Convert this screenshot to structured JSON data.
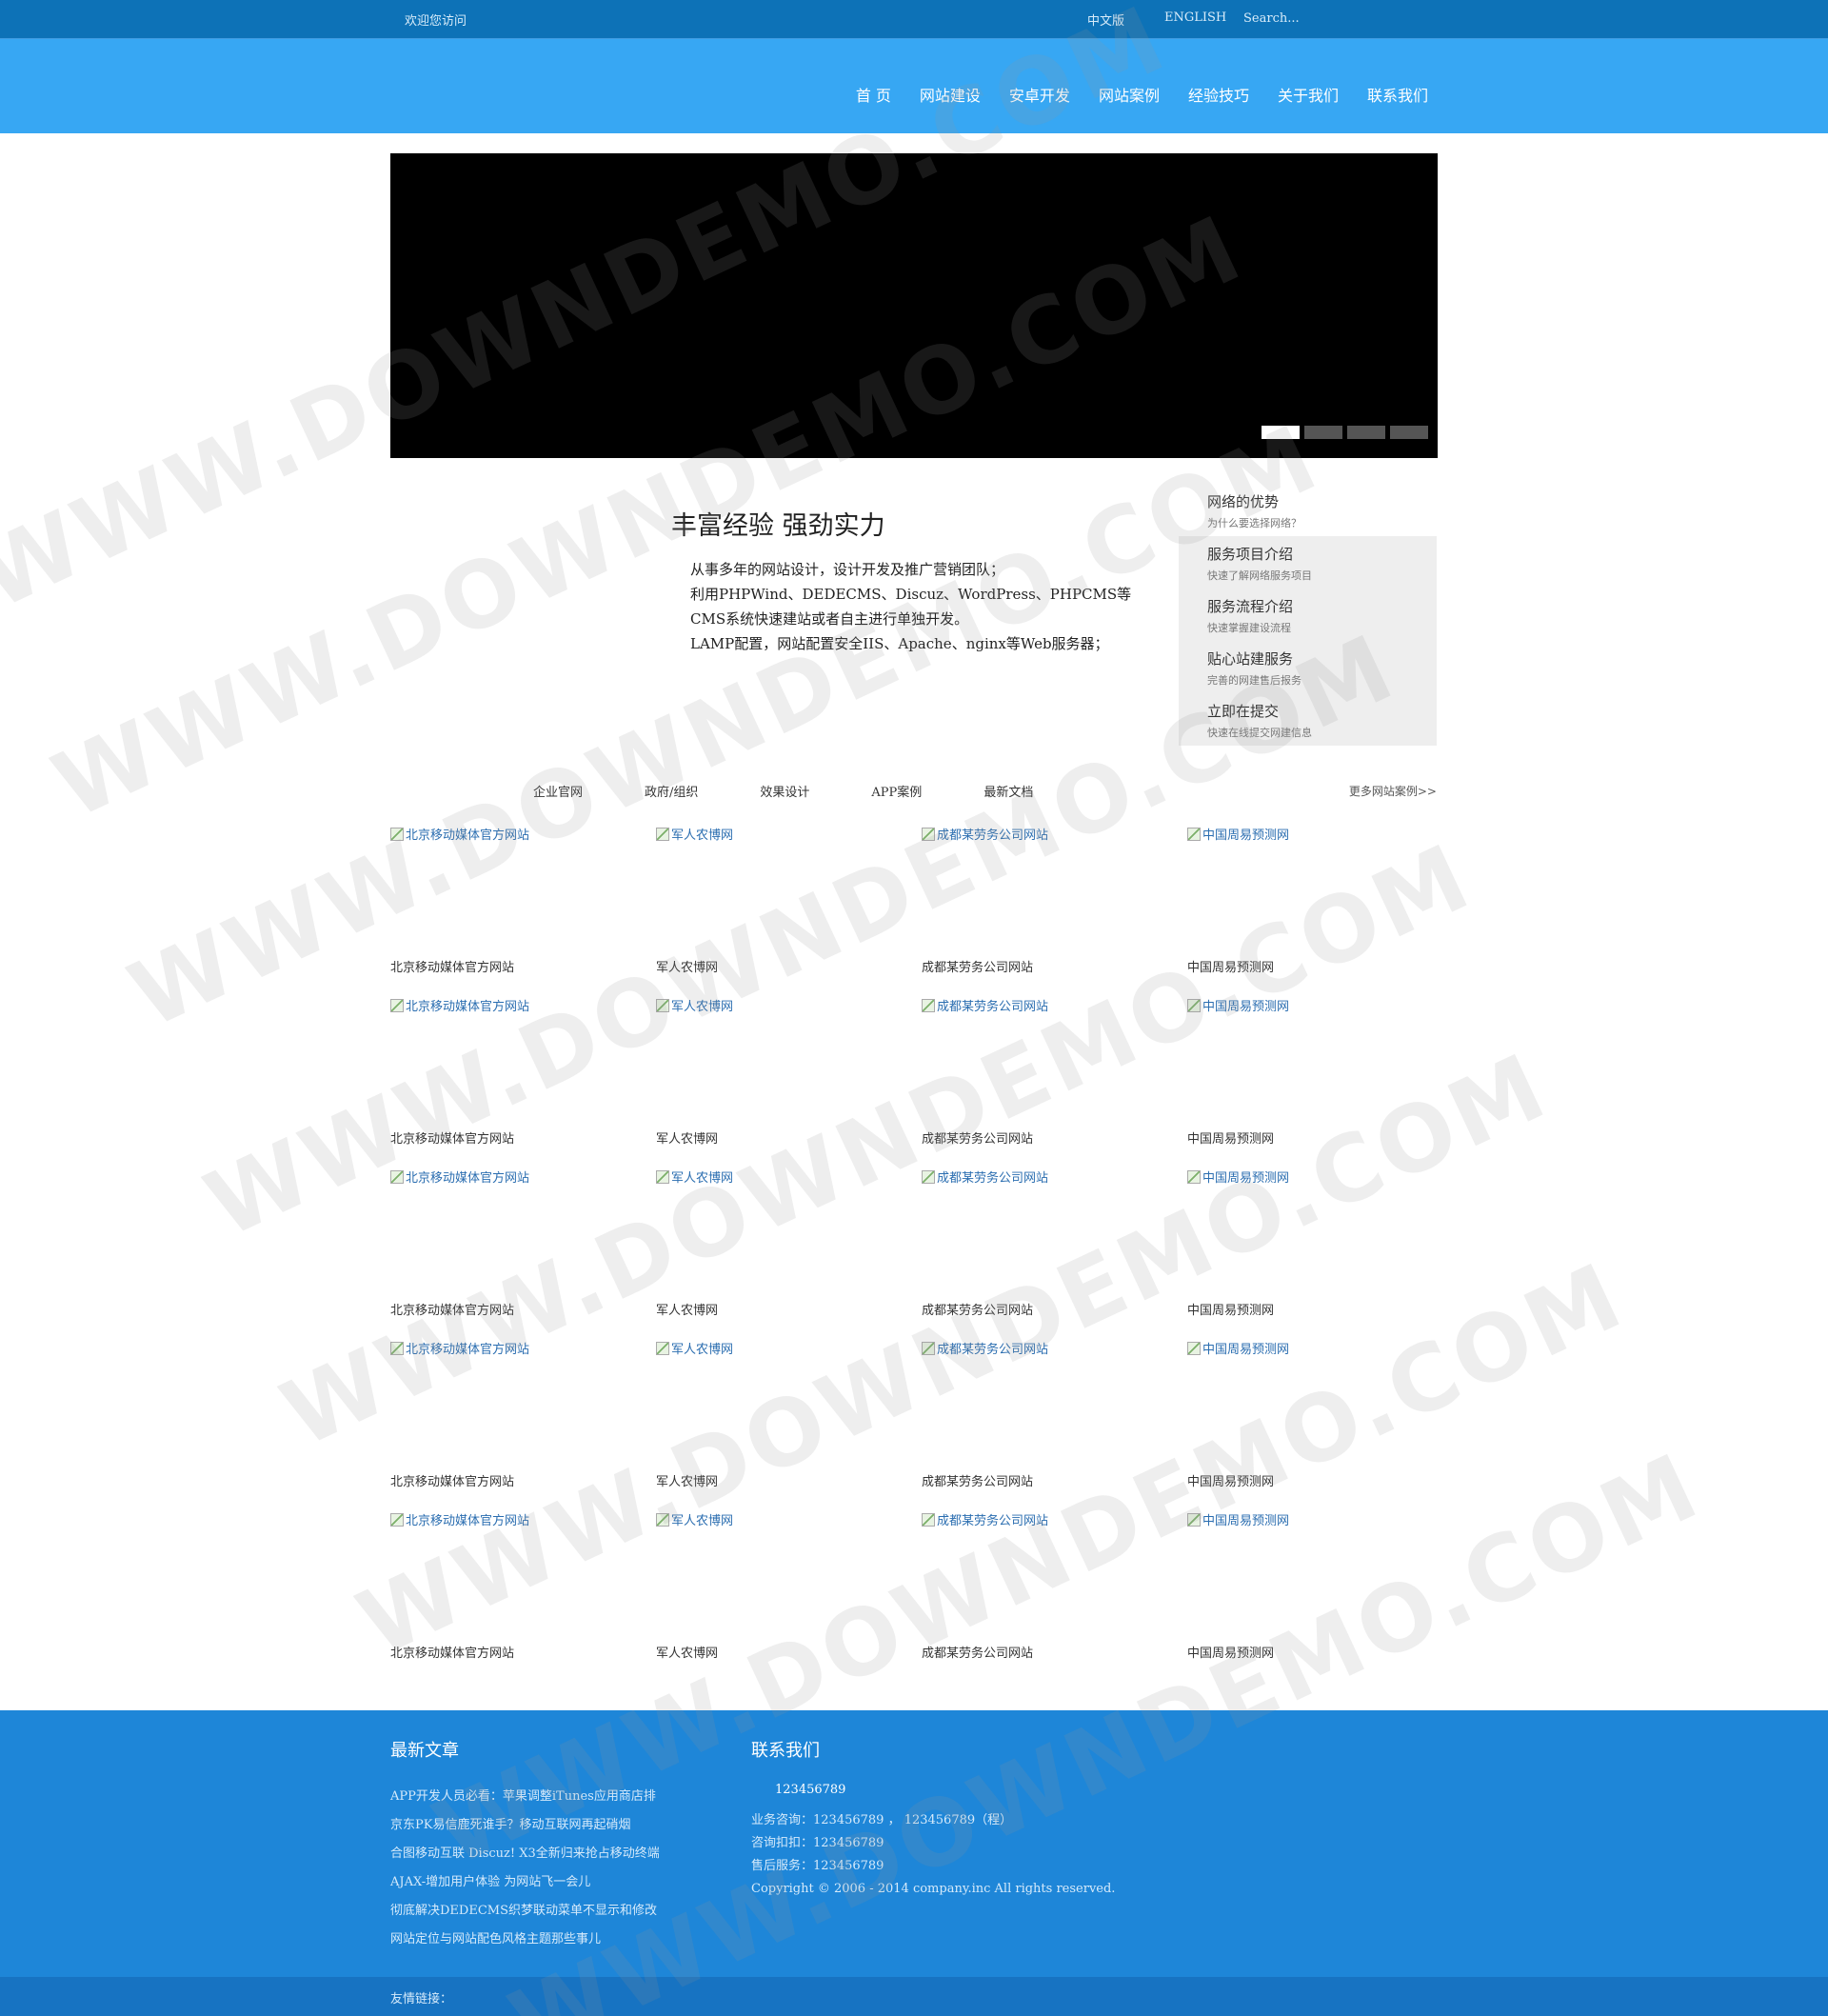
{
  "topbar": {
    "welcome": "欢迎您访问",
    "lang_cn": "中文版",
    "lang_en": "ENGLISH",
    "search_placeholder": "Search..."
  },
  "nav": {
    "items": [
      "首 页",
      "网站建设",
      "安卓开发",
      "网站案例",
      "经验技巧",
      "关于我们",
      "联系我们"
    ]
  },
  "banner": {
    "slides": 4,
    "active": 1
  },
  "intro": {
    "title": "丰富经验 强劲实力",
    "lines": [
      "从事多年的网站设计，设计开发及推广营销团队；",
      "利用PHPWind、DEDECMS、Discuz、WordPress、PHPCMS等CMS系统快速建站或者自主进行单独开发。",
      "LAMP配置，网站配置安全IIS、Apache、nginx等Web服务器；"
    ]
  },
  "sidebar": {
    "items": [
      {
        "title": "网络的优势",
        "sub": "为什么要选择网络？"
      },
      {
        "title": "服务项目介绍",
        "sub": "快速了解网络服务项目"
      },
      {
        "title": "服务流程介绍",
        "sub": "快速掌握建设流程"
      },
      {
        "title": "贴心站建服务",
        "sub": "完善的网建售后报务"
      },
      {
        "title": "立即在提交",
        "sub": "快速在线提交网建信息"
      }
    ]
  },
  "cases": {
    "tabs": [
      "企业官网",
      "政府/组织",
      "效果设计",
      "APP案例",
      "最新文档"
    ],
    "more": "更多网站案例>>",
    "items": [
      "北京移动媒体官方网站",
      "军人农博网",
      "成都某劳务公司网站",
      "中国周易预测网",
      "北京移动媒体官方网站",
      "军人农博网",
      "成都某劳务公司网站",
      "中国周易预测网",
      "北京移动媒体官方网站",
      "军人农博网",
      "成都某劳务公司网站",
      "中国周易预测网",
      "北京移动媒体官方网站",
      "军人农博网",
      "成都某劳务公司网站",
      "中国周易预测网",
      "北京移动媒体官方网站",
      "军人农博网",
      "成都某劳务公司网站",
      "中国周易预测网"
    ]
  },
  "footer": {
    "news_title": "最新文章",
    "news": [
      "APP开发人员必看：苹果调整iTunes应用商店排",
      "京东PK易信鹿死谁手？移动互联网再起硝烟",
      "合图移动互联 Discuz! X3全新归来抢占移动终端",
      "AJAX-增加用户体验 为网站飞一会儿",
      "彻底解决DEDECMS织梦联动菜单不显示和修改",
      "网站定位与网站配色风格主题那些事儿"
    ],
    "contact_title": "联系我们",
    "qq": "123456789",
    "contact_lines": [
      "业务咨询：123456789 ， 123456789（程）",
      "咨询扣扣：123456789",
      "售后服务：123456789",
      "Copyright © 2006 - 2014 company.inc All rights reserved."
    ],
    "links_label": "友情链接："
  },
  "watermark": "WWW.DOWNDEMO.COM"
}
